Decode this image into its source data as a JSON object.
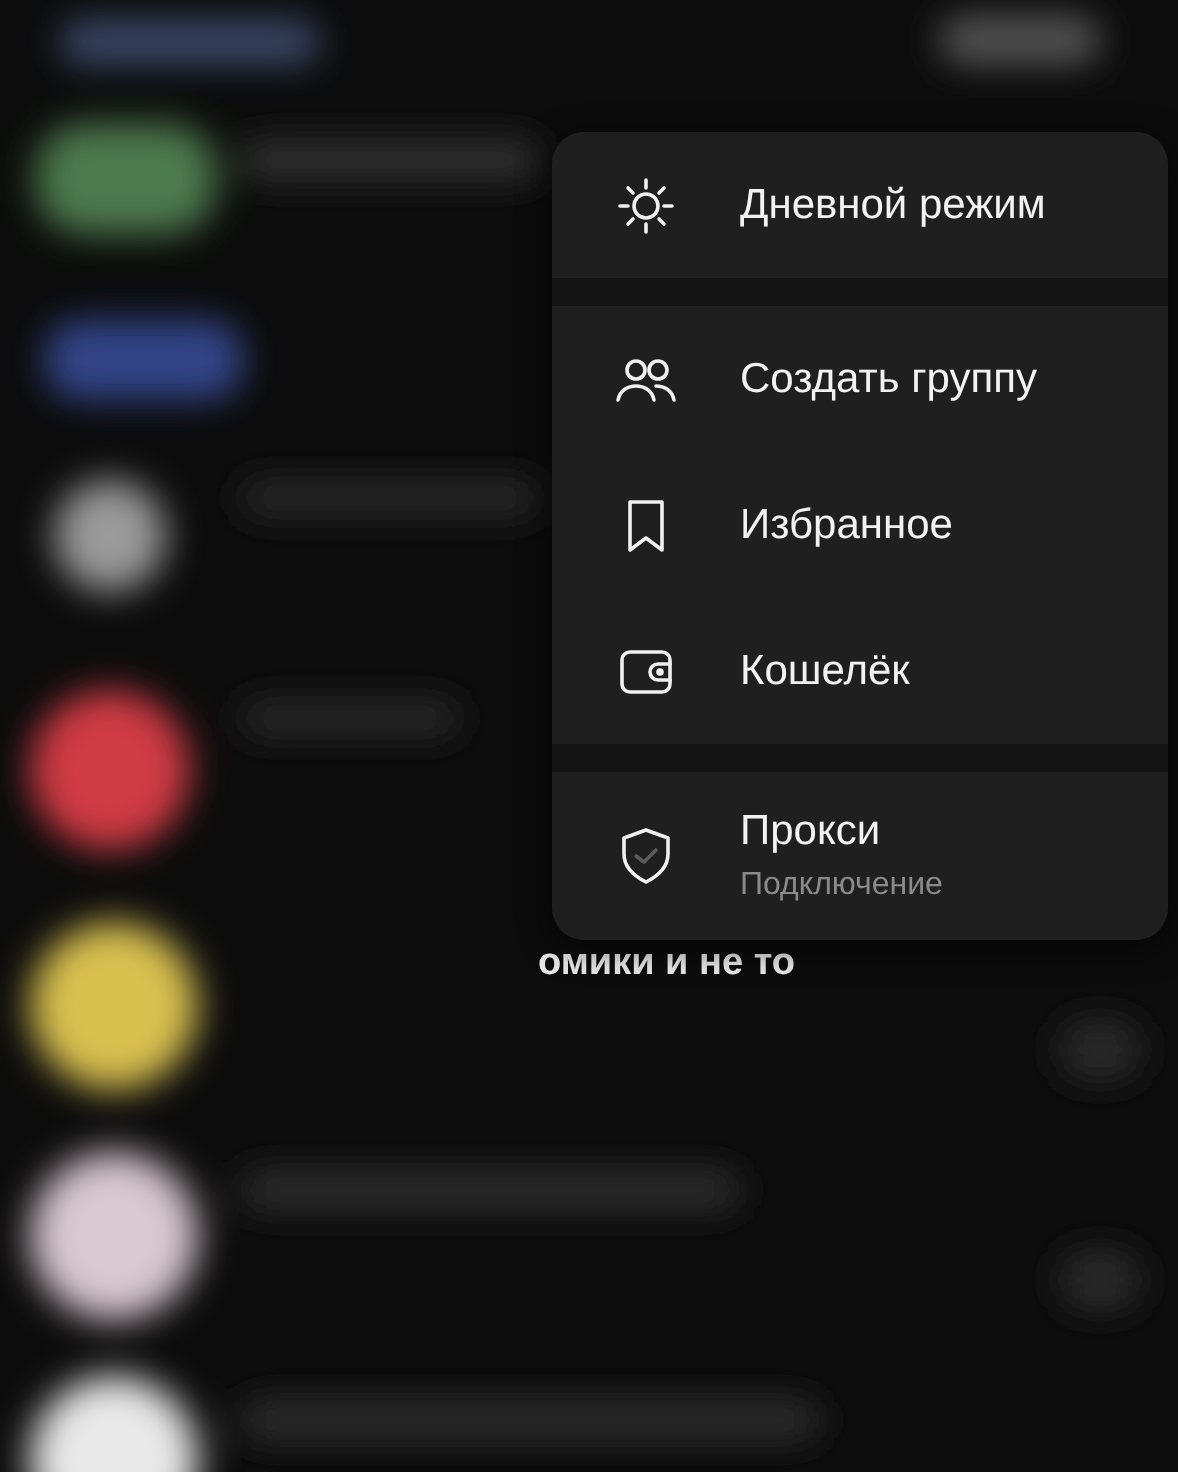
{
  "menu": {
    "sections": [
      {
        "items": [
          {
            "kind": "mode",
            "label": "Дневной режим"
          }
        ]
      },
      {
        "items": [
          {
            "kind": "group",
            "label": "Создать группу"
          },
          {
            "kind": "saved",
            "label": "Избранное"
          },
          {
            "kind": "wallet",
            "label": "Кошелёк"
          }
        ]
      },
      {
        "items": [
          {
            "kind": "proxy",
            "label": "Прокси",
            "subtitle": "Подключение"
          }
        ]
      }
    ]
  },
  "background": {
    "peek_text": "омики и не то"
  }
}
